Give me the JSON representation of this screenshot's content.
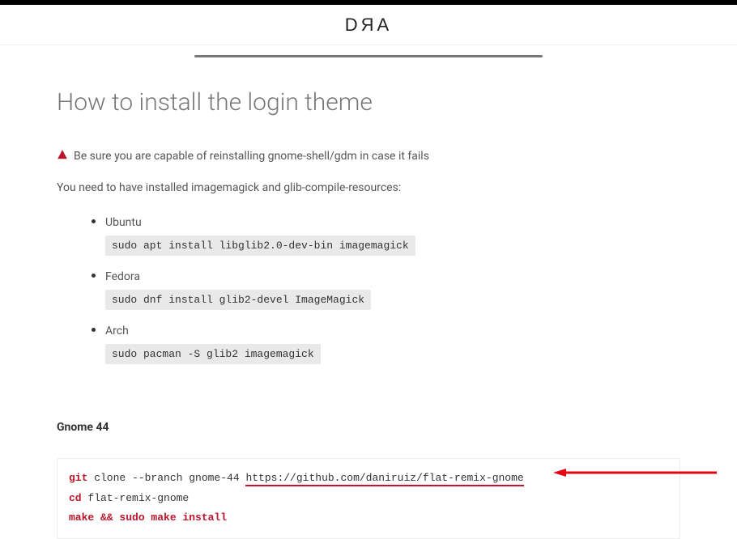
{
  "header": {
    "logo": "DЯA"
  },
  "title": "How to install the login theme",
  "warning": "Be sure you are capable of reinstalling gnome-shell/gdm in case it fails",
  "intro": "You need to have installed imagemagick and glib-compile-resources:",
  "distros": [
    {
      "name": "Ubuntu",
      "cmd": "sudo apt install libglib2.0-dev-bin imagemagick"
    },
    {
      "name": "Fedora",
      "cmd": "sudo dnf install glib2-devel ImageMagick"
    },
    {
      "name": "Arch",
      "cmd": "sudo pacman -S glib2 imagemagick"
    }
  ],
  "section_label": "Gnome 44",
  "code": {
    "line1_kw": "git",
    "line1_txt": " clone --branch gnome-44 ",
    "line1_url": "https://github.com/daniruiz/flat-remix-gnome",
    "line2_kw": "cd",
    "line2_txt": " flat-remix-gnome",
    "line3": "make && sudo make install"
  }
}
